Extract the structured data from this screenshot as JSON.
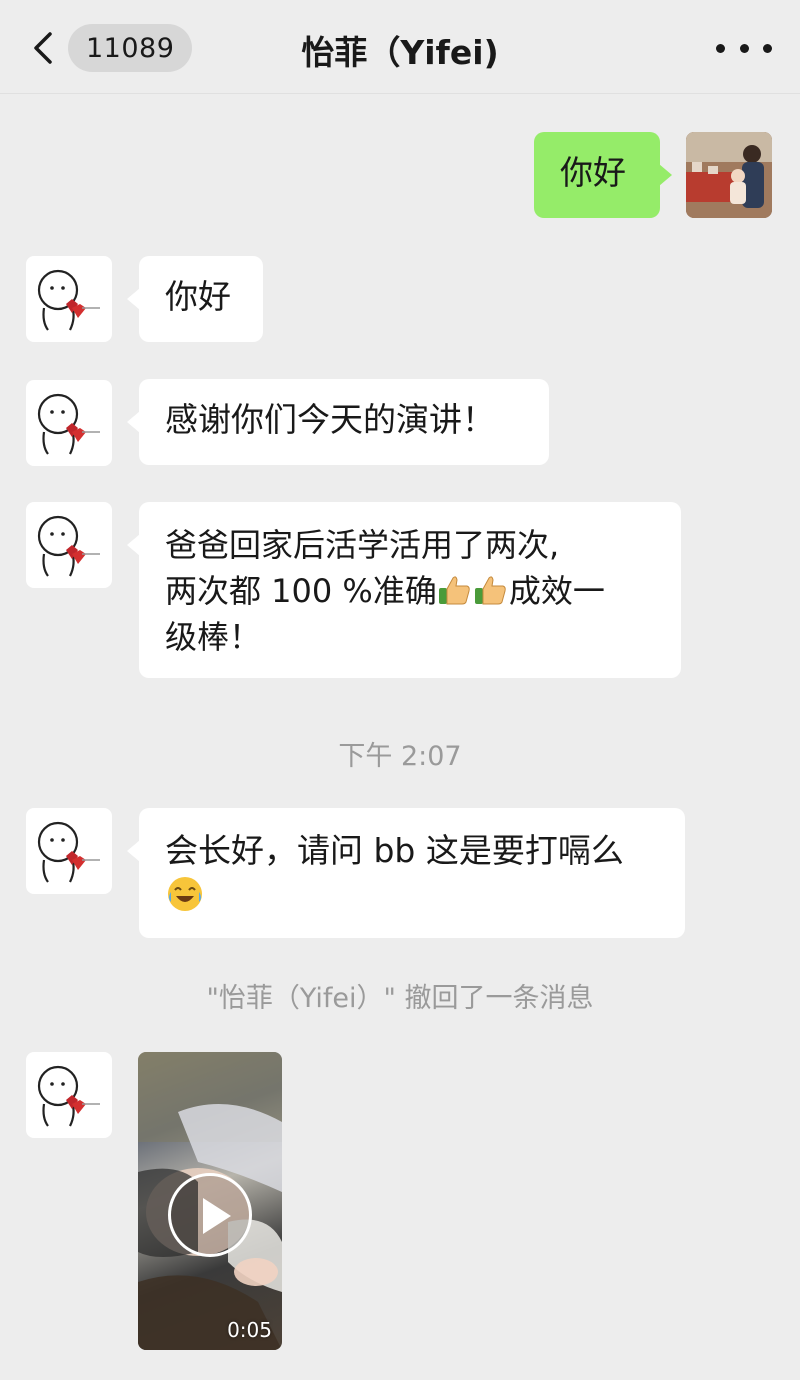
{
  "header": {
    "unread_count": "11089",
    "title": "怡菲（Yifei)",
    "back_icon": "chevron-left-icon",
    "more_icon": "more-dots-icon"
  },
  "colors": {
    "background": "#ededed",
    "self_bubble": "#95ec69",
    "other_bubble": "#ffffff",
    "system_text": "#9a9a9a"
  },
  "messages": [
    {
      "sender": "self",
      "text": "你好"
    },
    {
      "sender": "other",
      "text": "你好"
    },
    {
      "sender": "other",
      "text": "感谢你们今天的演讲！"
    },
    {
      "sender": "other",
      "line1": "爸爸回家后活学活用了两次,",
      "line2_a": "两次都 100 %准确",
      "line2_emoji": "thumbs-up-icon x2",
      "line2_b": "成效一",
      "line3": "级棒！"
    },
    {
      "sender": "other",
      "line1": "会长好，请问 bb 这是要打嗝么",
      "emoji": "laughing-crying-icon"
    },
    {
      "sender": "other",
      "type": "video",
      "duration": "0:05"
    }
  ],
  "timestamp": "下午 2:07",
  "recall_notice": "\"怡菲（Yifei）\" 撤回了一条消息"
}
